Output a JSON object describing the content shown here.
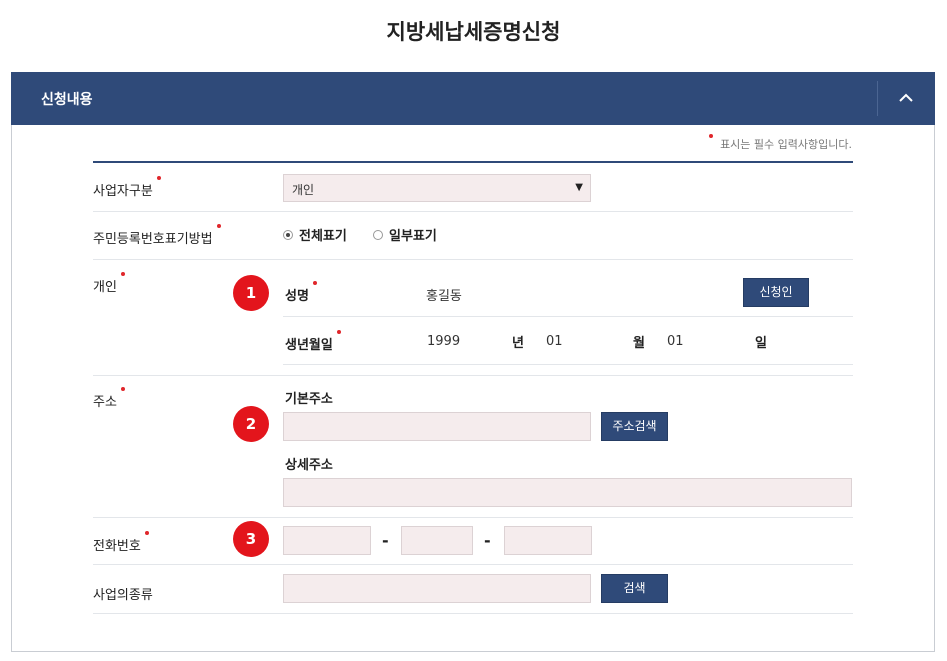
{
  "page": {
    "title": "지방세납세증명신청"
  },
  "panel": {
    "title": "신청내용",
    "collapse_icon": "chevron-up-icon"
  },
  "required_note": "표시는 필수 입력사항입니다.",
  "colors": {
    "header": "#2f4a79",
    "required": "#e0262b",
    "step_badge": "#e3151c",
    "input_bg": "#f5eced"
  },
  "form": {
    "business_type": {
      "label": "사업자구분",
      "selected": "개인"
    },
    "id_display": {
      "label": "주민등록번호표기방법",
      "options": [
        {
          "label": "전체표기",
          "checked": true
        },
        {
          "label": "일부표기",
          "checked": false
        }
      ]
    },
    "individual": {
      "label": "개인",
      "step": "1",
      "name_label": "성명",
      "name_value": "홍길동",
      "applicant_button": "신청인",
      "birth_label": "생년월일",
      "birth_year": "1999",
      "year_unit": "년",
      "birth_month": "01",
      "month_unit": "월",
      "birth_day": "01",
      "day_unit": "일"
    },
    "address": {
      "label": "주소",
      "step": "2",
      "basic_label": "기본주소",
      "search_button": "주소검색",
      "detail_label": "상세주소"
    },
    "phone": {
      "label": "전화번호",
      "step": "3",
      "separator": "-"
    },
    "business_kind": {
      "label": "사업의종류",
      "search_button": "검색"
    }
  }
}
